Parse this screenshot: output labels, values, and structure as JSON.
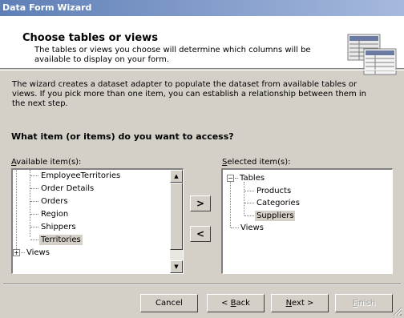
{
  "window": {
    "title": "Data Form Wizard"
  },
  "header": {
    "title": "Choose tables or views",
    "subtitle_lines": [
      "The tables or views you choose will determine which columns will be",
      "available to display on your form."
    ]
  },
  "description_lines": [
    "The wizard creates a dataset adapter to populate the dataset from available tables or",
    "views. If you pick more than one item, you can establish a relationship between them in",
    "the next step."
  ],
  "question": "What item (or items) do you want to access?",
  "available": {
    "label_mnemonic": "A",
    "label_rest": "vailable item(s):",
    "items": [
      "EmployeeTerritories",
      "Order Details",
      "Orders",
      "Region",
      "Shippers",
      "Territories"
    ],
    "selected_item": "Territories",
    "views_label": "Views",
    "views_expander": "+"
  },
  "selected": {
    "label_mnemonic": "S",
    "label_rest": "elected item(s):",
    "tables_label": "Tables",
    "tables_expander": "−",
    "children": [
      "Products",
      "Categories",
      "Suppliers"
    ],
    "highlighted_item": "Suppliers",
    "views_label": "Views"
  },
  "buttons": {
    "add": ">",
    "remove": "<",
    "cancel": "Cancel",
    "back_prefix": "< ",
    "back_mnemonic": "B",
    "back_rest": "ack",
    "next_mnemonic": "N",
    "next_rest": "ext >",
    "finish_mnemonic": "F",
    "finish_rest": "inish"
  },
  "scrollbar": {
    "up": "▲",
    "down": "▼"
  },
  "icons": {
    "header": "tables-icon",
    "resize": "resize-grip-icon"
  }
}
